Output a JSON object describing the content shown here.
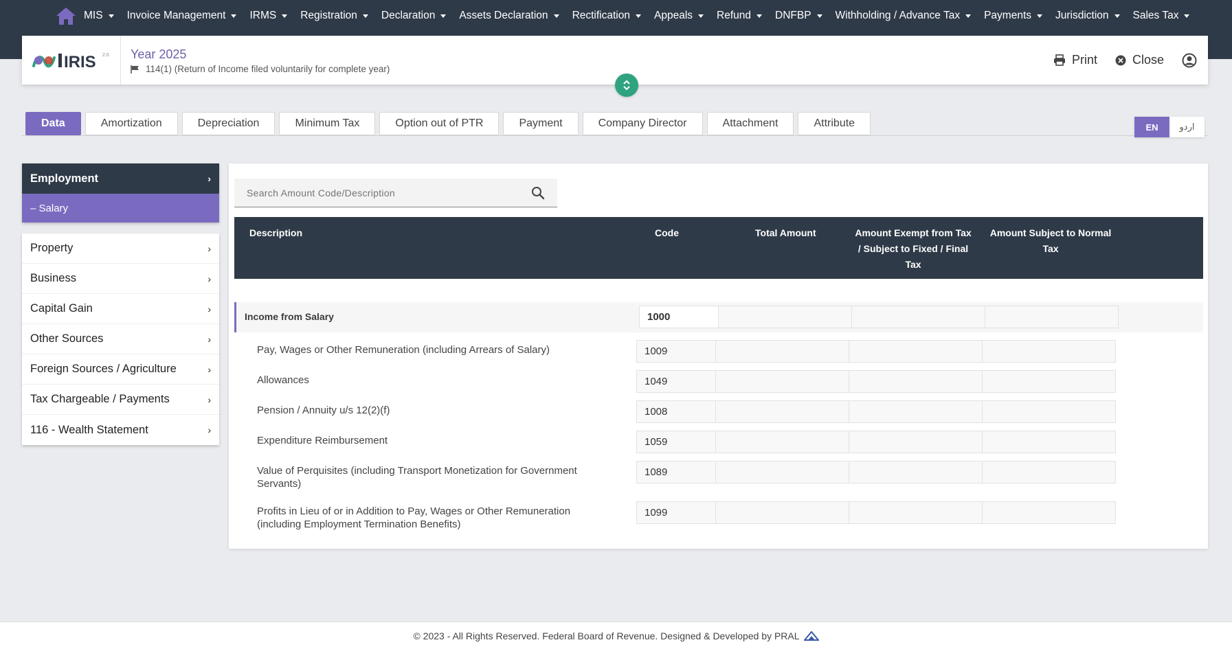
{
  "nav": {
    "items": [
      "MIS",
      "Invoice Management",
      "IRMS",
      "Registration",
      "Declaration",
      "Assets Declaration",
      "Rectification",
      "Appeals",
      "Refund",
      "DNFBP",
      "Withholding / Advance Tax",
      "Payments",
      "Jurisdiction",
      "Sales Tax"
    ]
  },
  "header": {
    "logo_text": "IRIS",
    "logo_version": "2.0",
    "year": "Year 2025",
    "form": "114(1) (Return of Income filed voluntarily for complete year)",
    "print_label": "Print",
    "close_label": "Close"
  },
  "tabs": [
    "Data",
    "Amortization",
    "Depreciation",
    "Minimum Tax",
    "Option out of PTR",
    "Payment",
    "Company Director",
    "Attachment",
    "Attribute"
  ],
  "active_tab": "Data",
  "lang": {
    "en": "EN",
    "ur": "اردو"
  },
  "sidebar": {
    "section": "Employment",
    "sub_item": "– Salary",
    "items": [
      "Property",
      "Business",
      "Capital Gain",
      "Other Sources",
      "Foreign Sources / Agriculture",
      "Tax Chargeable / Payments",
      "116 - Wealth Statement"
    ]
  },
  "search": {
    "placeholder": "Search Amount Code/Description"
  },
  "table": {
    "headers": {
      "description": "Description",
      "code": "Code",
      "total": "Total Amount",
      "exempt": "Amount Exempt from Tax / Subject to Fixed / Final Tax",
      "normal": "Amount Subject to Normal Tax"
    },
    "group": {
      "description": "Income from Salary",
      "code": "1000"
    },
    "rows": [
      {
        "description": "Pay, Wages or Other Remuneration (including Arrears of Salary)",
        "code": "1009"
      },
      {
        "description": "Allowances",
        "code": "1049"
      },
      {
        "description": "Pension / Annuity u/s 12(2)(f)",
        "code": "1008"
      },
      {
        "description": "Expenditure Reimbursement",
        "code": "1059"
      },
      {
        "description": "Value of Perquisites (including Transport Monetization for Government Servants)",
        "code": "1089"
      },
      {
        "description": "Profits in Lieu of or in Addition to Pay, Wages or Other Remuneration (including Employment Termination Benefits)",
        "code": "1099"
      }
    ]
  },
  "footer": {
    "text": "© 2023 - All Rights Reserved. Federal Board of Revenue. Designed & Developed by PRAL"
  },
  "colors": {
    "nav_bg": "#2f3a48",
    "accent": "#7a6bc0",
    "collapse_btn": "#2fa380"
  }
}
